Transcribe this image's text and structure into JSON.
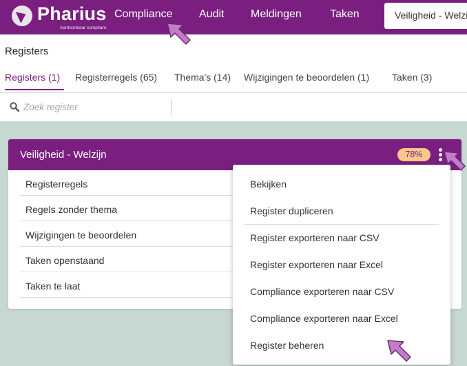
{
  "topbar": {
    "logo_name": "Pharius",
    "logo_tagline": "Aantoonbaar compliant.",
    "nav": [
      "Compliance",
      "Audit",
      "Meldingen",
      "Taken"
    ],
    "register_selector": "Veiligheid - Welzijn",
    "accent_color": "#7a1f80"
  },
  "page": {
    "title": "Registers",
    "tabs": [
      "Registers (1)",
      "Registerregels (65)",
      "Thema's (14)",
      "Wijzigingen te beoordelen (1)",
      "Taken (3)"
    ],
    "active_tab": "Registers (1)"
  },
  "search": {
    "placeholder": "Zoek register",
    "icon": "search-icon"
  },
  "register_card": {
    "title": "Veiligheid - Welzijn",
    "score": "78%",
    "badge_color": "#f7c889",
    "links": [
      "Registerregels",
      "Regels zonder thema",
      "Wijzigingen te beoordelen",
      "Taken openstaand",
      "Taken te laat"
    ]
  },
  "context_menu": {
    "items": [
      "Bekijken",
      "Register dupliceren",
      "Register exporteren naar CSV",
      "Register exporteren naar Excel",
      "Compliance exporteren naar CSV",
      "Compliance exporteren naar Excel",
      "Register beheren"
    ]
  },
  "annotations": {
    "pointer_color": "#c47cc9",
    "icon": "arrow-pointer-icon"
  }
}
